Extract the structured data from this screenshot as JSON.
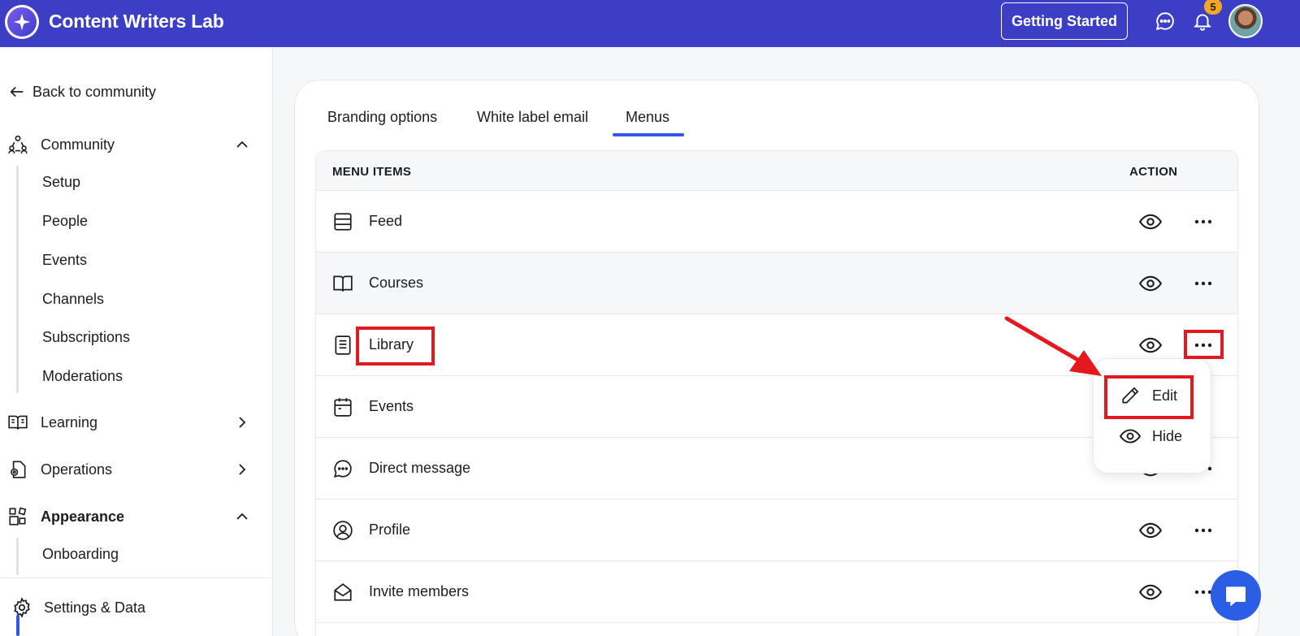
{
  "app": {
    "title": "Content Writers Lab"
  },
  "header": {
    "getting_started": "Getting Started",
    "notification_count": "5"
  },
  "sidebar": {
    "back": "Back to community",
    "sections": [
      {
        "label": "Community",
        "icon": "community-icon",
        "expanded": true,
        "items": [
          "Setup",
          "People",
          "Events",
          "Channels",
          "Subscriptions",
          "Moderations"
        ]
      },
      {
        "label": "Learning",
        "icon": "book-icon",
        "expanded": false
      },
      {
        "label": "Operations",
        "icon": "operations-icon",
        "expanded": false
      },
      {
        "label": "Appearance",
        "icon": "appearance-icon",
        "expanded": true,
        "items": [
          "Onboarding"
        ]
      }
    ],
    "settings": "Settings & Data"
  },
  "tabs": [
    {
      "label": "Branding options",
      "active": false
    },
    {
      "label": "White label email",
      "active": false
    },
    {
      "label": "Menus",
      "active": true
    }
  ],
  "table": {
    "col_items": "MENU ITEMS",
    "col_action": "ACTION",
    "rows": [
      {
        "label": "Feed",
        "icon": "feed-icon"
      },
      {
        "label": "Courses",
        "icon": "book-open-icon"
      },
      {
        "label": "Library",
        "icon": "library-icon"
      },
      {
        "label": "Events",
        "icon": "calendar-icon"
      },
      {
        "label": "Direct message",
        "icon": "chat-bubble-icon"
      },
      {
        "label": "Profile",
        "icon": "profile-icon"
      },
      {
        "label": "Invite members",
        "icon": "envelope-open-icon"
      }
    ]
  },
  "dropdown": {
    "edit": "Edit",
    "hide": "Hide"
  },
  "colors": {
    "brand": "#3d3ec6",
    "accent": "#3557e6",
    "annotation": "#e3191f",
    "badge": "#f5a623"
  }
}
